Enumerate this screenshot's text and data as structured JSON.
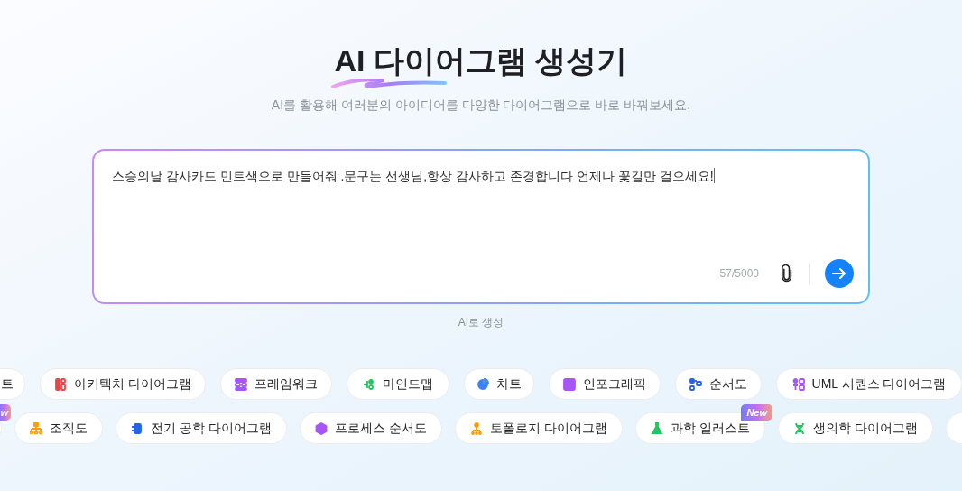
{
  "title": "AI 다이어그램 생성기",
  "subtitle": "AI를 활용해 여러분의 아이디어를 다양한 다이어그램으로 바로 바꿔보세요.",
  "prompt": {
    "value": "스승의날 감사카드 민트색으로 만들어줘 .문구는 선생님,항상 감사하고 존경합니다 언제나 꽃길만 걸으세요!",
    "focused": true,
    "counter": "57/5000"
  },
  "caption": "AI로 생성",
  "chip_rows": [
    [
      {
        "label": "트"
      },
      {
        "label": "아키텍처 다이어그램",
        "color": "#ef4444"
      },
      {
        "label": "프레임워크",
        "color": "#a855f7"
      },
      {
        "label": "마인드맵",
        "color": "#22c55e"
      },
      {
        "label": "차트",
        "color": "#3b82f6"
      },
      {
        "label": "인포그래픽",
        "color": "#a855f7"
      },
      {
        "label": "순서도",
        "color": "#2563eb"
      },
      {
        "label": "UML 시퀀스 다이어그램",
        "color": "#a855f7"
      }
    ],
    [
      {
        "badge": "w"
      },
      {
        "label": "조직도",
        "color": "#f59e0b"
      },
      {
        "label": "전기 공학 다이어그램",
        "color": "#2563eb"
      },
      {
        "label": "프로세스 순서도",
        "color": "#a855f7"
      },
      {
        "label": "토폴로지 다이어그램",
        "color": "#f59e0b"
      },
      {
        "label": "과학 일러스트",
        "color": "#22c55e",
        "badge": "New"
      },
      {
        "label": "생의학 다이어그램",
        "color": "#22c55e"
      },
      {}
    ]
  ]
}
